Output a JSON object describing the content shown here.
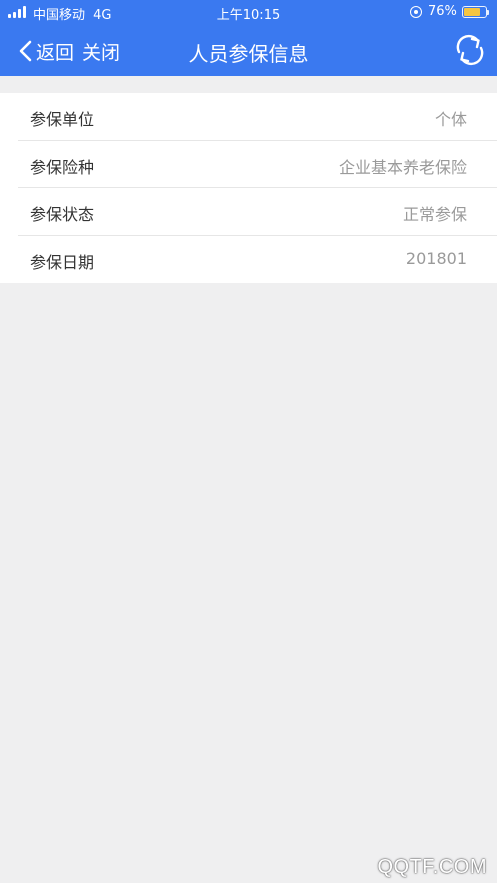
{
  "status_bar": {
    "carrier": "中国移动",
    "network": "4G",
    "time": "上午10:15",
    "battery_percent": "76%",
    "battery_level": 0.76,
    "battery_color": "#f5c542"
  },
  "nav": {
    "back_label": "返回",
    "close_label": "关闭",
    "title": "人员参保信息",
    "refresh_icon": "refresh-icon",
    "background_color": "#3a79f0"
  },
  "insurance_info": {
    "rows": [
      {
        "label": "参保单位",
        "value": "个体"
      },
      {
        "label": "参保险种",
        "value": "企业基本养老保险"
      },
      {
        "label": "参保状态",
        "value": "正常参保"
      },
      {
        "label": "参保日期",
        "value": "201801"
      }
    ]
  },
  "watermark": "QQTF.COM"
}
